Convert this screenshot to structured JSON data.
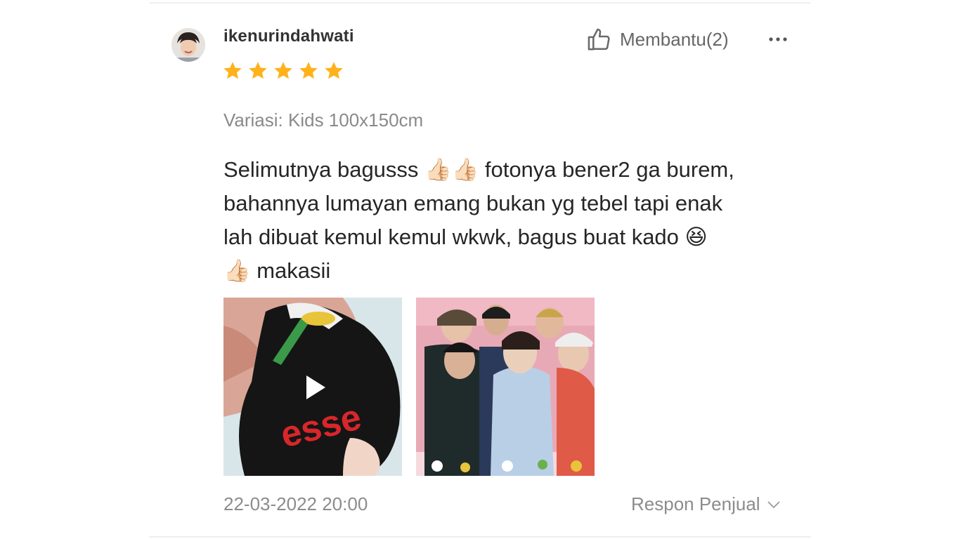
{
  "review": {
    "username": "ikenurindahwati",
    "rating": 5,
    "rating_max": 5,
    "helpful_label": "Membantu(2)",
    "variant": "Variasi: Kids 100x150cm",
    "text": "Selimutnya bagusss 👍🏻👍🏻 fotonya bener2 ga burem,\nbahannya lumayan emang bukan yg tebel tapi enak\nlah dibuat kemul kemul wkwk, bagus buat kado 😆\n👍🏻 makasii",
    "media_1_overlay_text": "esse",
    "date": "22-03-2022 20:00",
    "seller_response_label": "Respon Penjual"
  },
  "colors": {
    "star": "#FFB21C",
    "text_primary": "#262626",
    "text_secondary": "#8c8c8c"
  },
  "icons": {
    "helpful": "thumbs-up-icon",
    "more": "more-horizontal-icon",
    "play": "play-icon",
    "expand": "chevron-down-icon"
  }
}
